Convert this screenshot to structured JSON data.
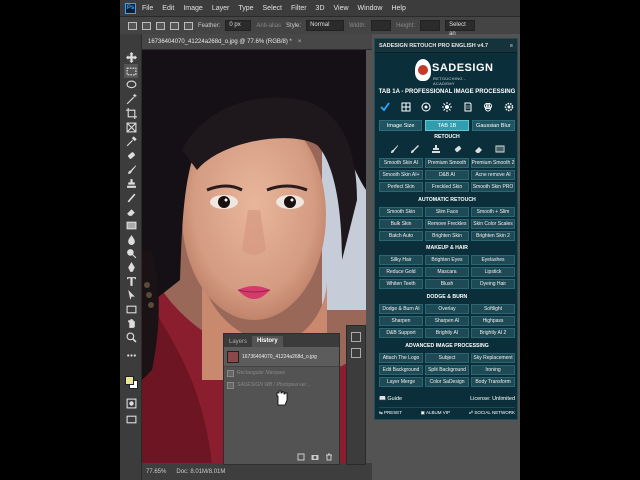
{
  "menubar": {
    "app_icon": "Ps",
    "items": [
      "File",
      "Edit",
      "Image",
      "Layer",
      "Type",
      "Select",
      "Filter",
      "3D",
      "View",
      "Window",
      "Help"
    ]
  },
  "options_bar": {
    "feather_label": "Feather:",
    "feather_value": "0 px",
    "anti_alias": "Anti-alias",
    "style_label": "Style:",
    "style_value": "Normal",
    "width_label": "Width:",
    "height_label": "Height:",
    "select_and_mask": "Select an"
  },
  "document": {
    "tab_title": "16736404070_41224a268d_o.jpg @ 77.6% (RGB/8) *",
    "close": "×",
    "zoom": "77.65%",
    "doc_info": "Doc: 8.01M/8.01M"
  },
  "history": {
    "tabs": [
      "Layers",
      "History"
    ],
    "snapshot": "16736404070_41224a268d_o.jpg",
    "states": [
      "Rectangular Marquee",
      "SADESIGN WB / Photopea ver..."
    ]
  },
  "panel": {
    "title": "SADESIGN RETOUCH PRO ENGLISH v4.7",
    "logo_name": "SADESIGN",
    "logo_sub": "RETOUCHING - ACADEMY",
    "tab_title": "TAB 1A - PROFESSIONAL IMAGE PROCESSING",
    "top_tabs": [
      "Image Size",
      "TAB 1B",
      "Gaussian Blur"
    ],
    "sections": [
      {
        "label": "RETOUCH",
        "buttons": [
          "Smooth Skin AI",
          "Premium Smooth",
          "Premium Smooth 2",
          "Smooth Skin AI+",
          "D&B AI",
          "Acne remove AI",
          "Perfect Skin",
          "Freckled Skin",
          "Smooth Skin PRO"
        ]
      },
      {
        "label": "AUTOMATIC RETOUCH",
        "buttons": [
          "Smooth Skin",
          "Slim Face",
          "Smooth + Slim",
          "Bulk Skin",
          "Remove Freckles",
          "Skin Color Scales",
          "Batch Auto",
          "Brighten Skin",
          "Brighten Skin 2"
        ]
      },
      {
        "label": "MAKEUP & HAIR",
        "buttons": [
          "Silky Hair",
          "Brighten Eyes",
          "Eyelashes",
          "Reduce Gold",
          "Mascara",
          "Lipstick",
          "Whiten Teeth",
          "Blush",
          "Dyeing Hair"
        ]
      },
      {
        "label": "DODGE & BURN",
        "buttons": [
          "Dodge & Burn AI",
          "Overlay",
          "Softlight",
          "Sharpen",
          "Sharpen AI",
          "Highpass",
          "D&B Support",
          "Brightly AI",
          "Brightly AI 2"
        ]
      },
      {
        "label": "ADVANCED IMAGE PROCESSING",
        "buttons": [
          "Attach The Logo",
          "Subject",
          "Sky Replacement",
          "Edit Background",
          "Split Background",
          "Ironing",
          "Layer Merge",
          "Color SaDesign",
          "Body Transform"
        ]
      }
    ],
    "guide": "Guide",
    "license": "License: Unlimited",
    "footer": [
      "PRESET",
      "ALBUM VIP",
      "SOCIAL NETWORK"
    ]
  }
}
